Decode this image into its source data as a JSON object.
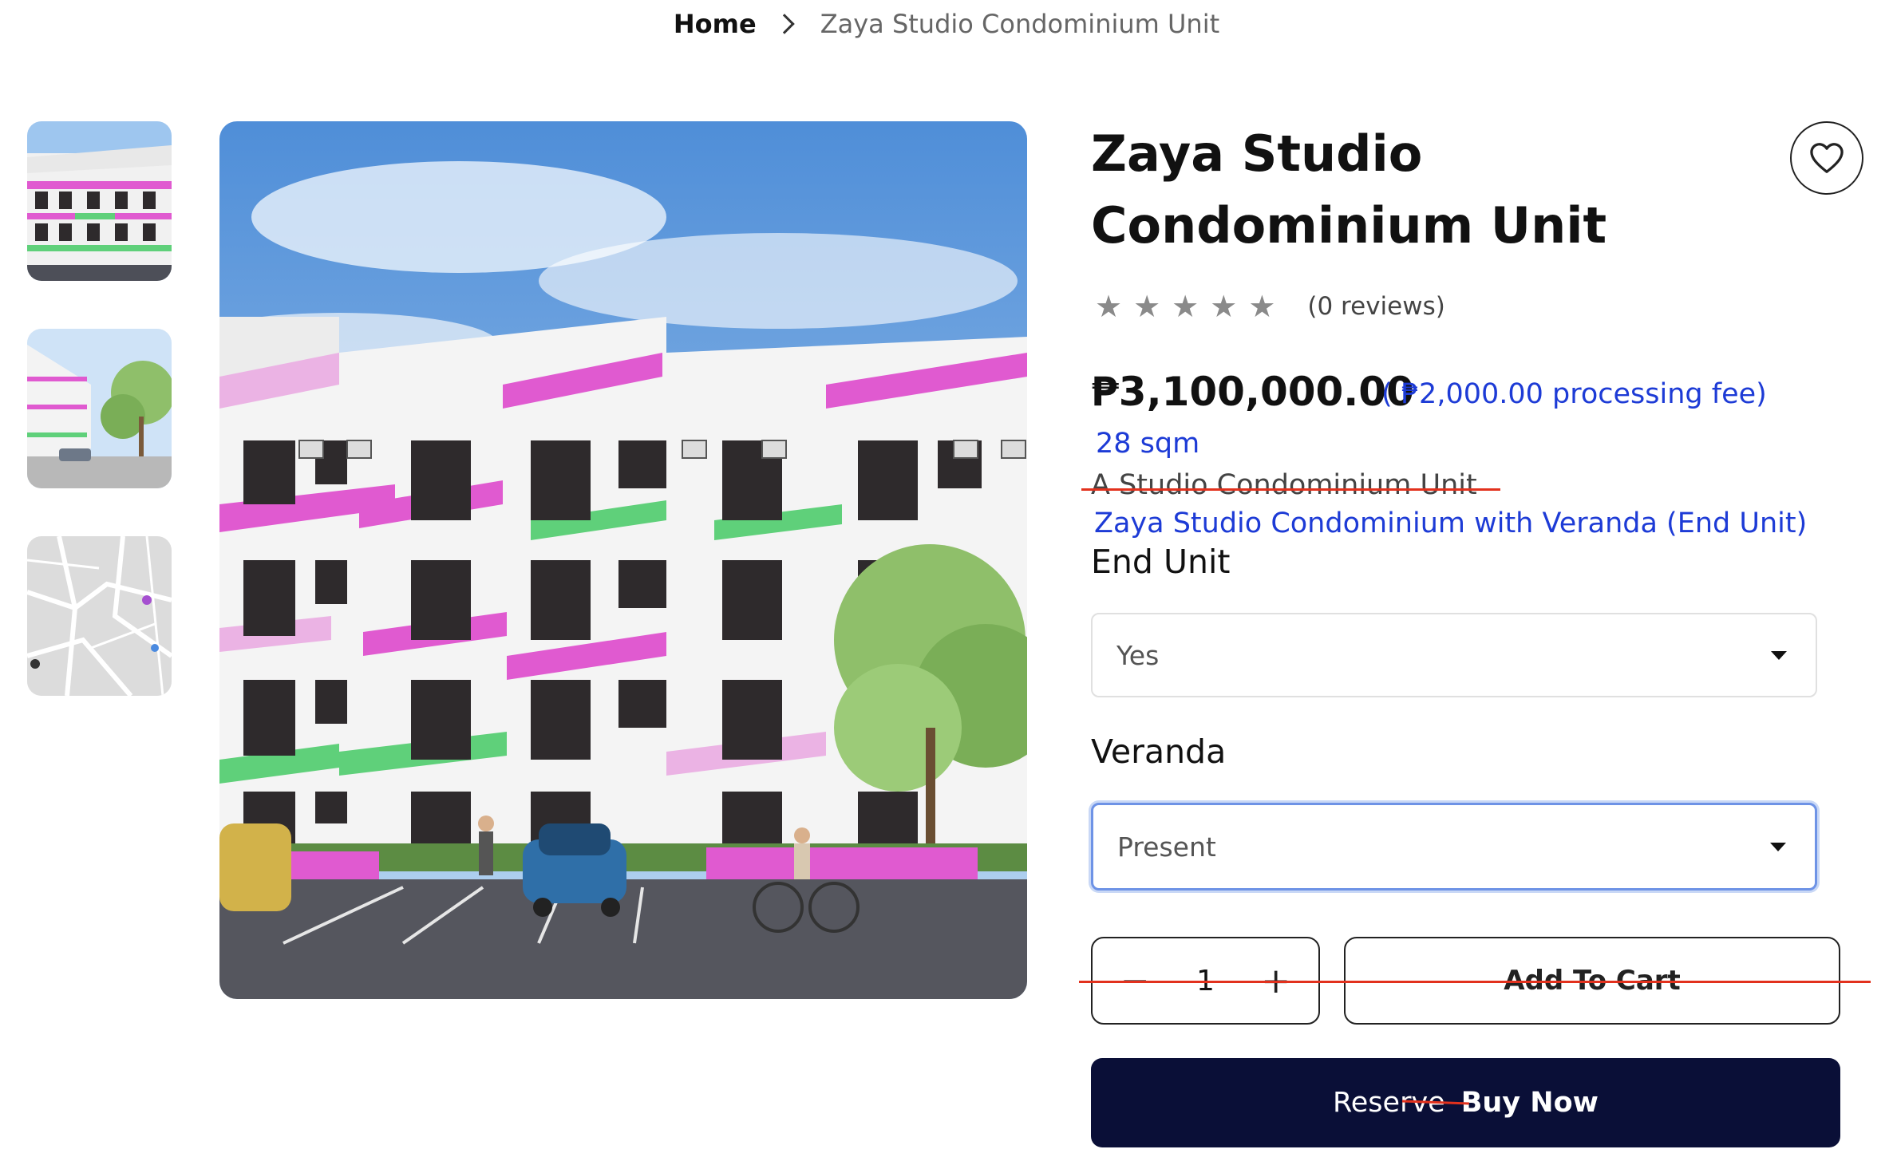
{
  "breadcrumb": {
    "home": "Home",
    "current": "Zaya Studio Condominium Unit"
  },
  "product": {
    "title": "Zaya Studio Condominium Unit",
    "rating_stars": 5,
    "reviews": "(0 reviews)",
    "price": "₱3,100,000.00",
    "processing_fee": "( ₱2,000.00 processing fee)",
    "area": "28 sqm",
    "old_description": "A Studio Condominium Unit",
    "new_description": "Zaya Studio Condominium with Veranda (End Unit)"
  },
  "options": {
    "end_unit_label": "End Unit",
    "end_unit_value": "Yes",
    "veranda_label": "Veranda",
    "veranda_value": "Present"
  },
  "cart": {
    "quantity": "1",
    "minus": "−",
    "plus": "+",
    "add_to_cart": "Add To Cart"
  },
  "reserve": {
    "reserve_label": "Reserve",
    "buy_now_label": "Buy Now"
  },
  "icons": {
    "wishlist": "heart-icon",
    "separator": "chevron-right-icon",
    "star": "star-icon",
    "dropdown": "caret-down-icon"
  },
  "colors": {
    "accent_blue": "#1d3bd6",
    "strike_red": "#e2311d",
    "button_dark": "#0a0f37",
    "building_pink": "#e05ad0",
    "building_green": "#5fd07a"
  }
}
